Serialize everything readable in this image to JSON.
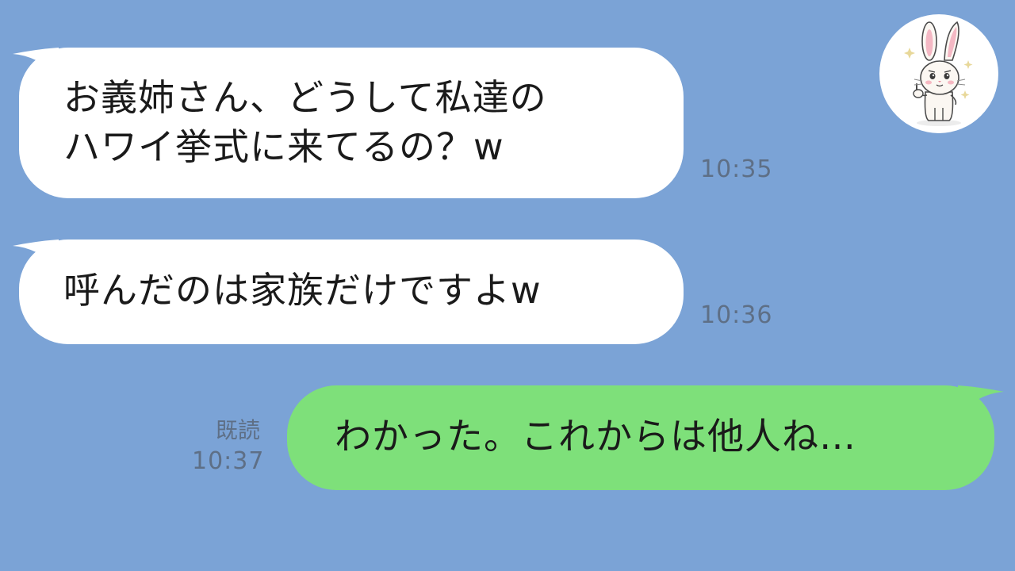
{
  "chat": {
    "messages": [
      {
        "lines": [
          "お義姉さん、どうして私達の",
          "ハワイ挙式に来てるの？w"
        ],
        "time": "10:35",
        "direction": "incoming"
      },
      {
        "lines": [
          "呼んだのは家族だけですよw"
        ],
        "time": "10:36",
        "direction": "incoming"
      },
      {
        "lines": [
          "わかった。これからは他人ね…"
        ],
        "time": "10:37",
        "read_label": "既読",
        "direction": "outgoing"
      }
    ]
  },
  "avatar": {
    "icon": "rabbit-avatar-icon"
  },
  "colors": {
    "background": "#7ba3d6",
    "incoming_bubble": "#ffffff",
    "outgoing_bubble": "#7ee07a",
    "timestamp": "#5e6f86"
  }
}
